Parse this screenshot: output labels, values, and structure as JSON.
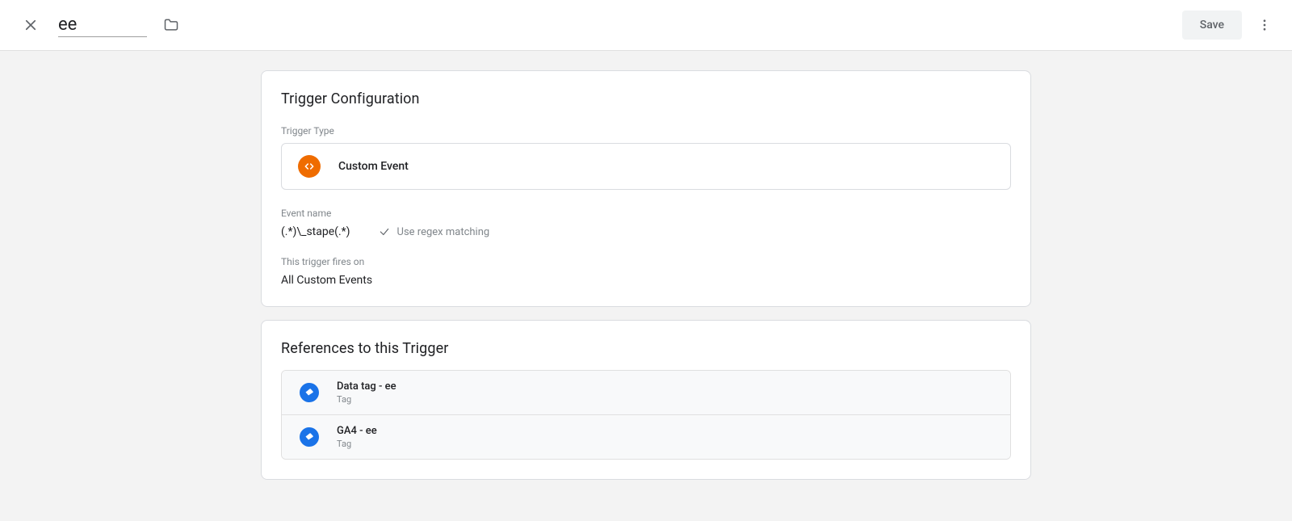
{
  "topbar": {
    "title_value": "ee",
    "save_label": "Save"
  },
  "trigger_config": {
    "heading": "Trigger Configuration",
    "type_label": "Trigger Type",
    "type_name": "Custom Event",
    "event_name_label": "Event name",
    "event_name_value": "(.*)\\_stape(.*)",
    "regex_label": "Use regex matching",
    "fires_label": "This trigger fires on",
    "fires_value": "All Custom Events"
  },
  "references": {
    "heading": "References to this Trigger",
    "items": [
      {
        "name": "Data tag - ee",
        "type": "Tag"
      },
      {
        "name": "GA4 - ee",
        "type": "Tag"
      }
    ]
  }
}
